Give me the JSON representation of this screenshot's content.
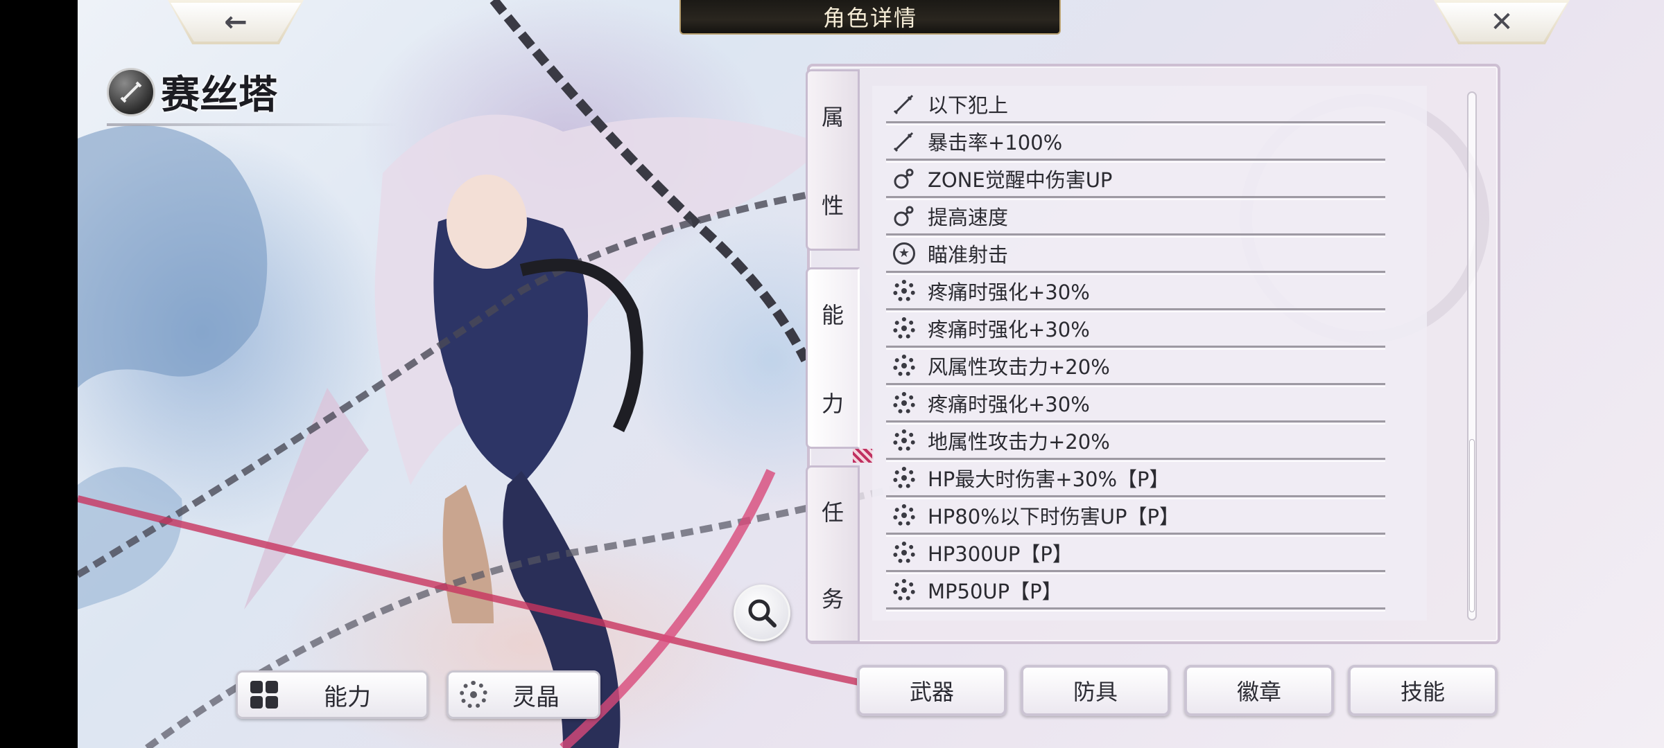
{
  "header": {
    "title": "角色详情",
    "back_glyph": "←",
    "close_glyph": "✕"
  },
  "character": {
    "name": "赛丝塔",
    "class_icon": "sword-class-icon"
  },
  "side_tabs": [
    {
      "label_1": "属",
      "label_2": "性"
    },
    {
      "label_1": "能",
      "label_2": "力"
    },
    {
      "label_1": "任",
      "label_2": "务"
    }
  ],
  "abilities": [
    {
      "icon": "sword-icon",
      "text": "以下犯上"
    },
    {
      "icon": "sword-icon",
      "text": "暴击率+100%"
    },
    {
      "icon": "flask-icon",
      "text": "ZONE觉醒中伤害UP"
    },
    {
      "icon": "flask-icon",
      "text": "提高速度"
    },
    {
      "icon": "star-badge-icon",
      "text": "瞄准射击"
    },
    {
      "icon": "gear-icon",
      "text": "疼痛时强化+30%"
    },
    {
      "icon": "gear-icon",
      "text": "疼痛时强化+30%"
    },
    {
      "icon": "gear-icon",
      "text": "风属性攻击力+20%"
    },
    {
      "icon": "gear-icon",
      "text": "疼痛时强化+30%"
    },
    {
      "icon": "gear-icon",
      "text": "地属性攻击力+20%"
    },
    {
      "icon": "gear-icon",
      "text": "HP最大时伤害+30%【P】"
    },
    {
      "icon": "gear-icon",
      "text": "HP80%以下时伤害UP【P】"
    },
    {
      "icon": "gear-icon",
      "text": "HP300UP【P】"
    },
    {
      "icon": "gear-icon",
      "text": "MP50UP【P】"
    }
  ],
  "bottom_left": {
    "ability_label": "能力",
    "spirit_label": "灵晶"
  },
  "bottom_right": [
    "武器",
    "防具",
    "徽章",
    "技能"
  ],
  "colors": {
    "title_bar": "#1b1915",
    "panel_border": "#cdbfd2",
    "accent": "#c03060"
  }
}
